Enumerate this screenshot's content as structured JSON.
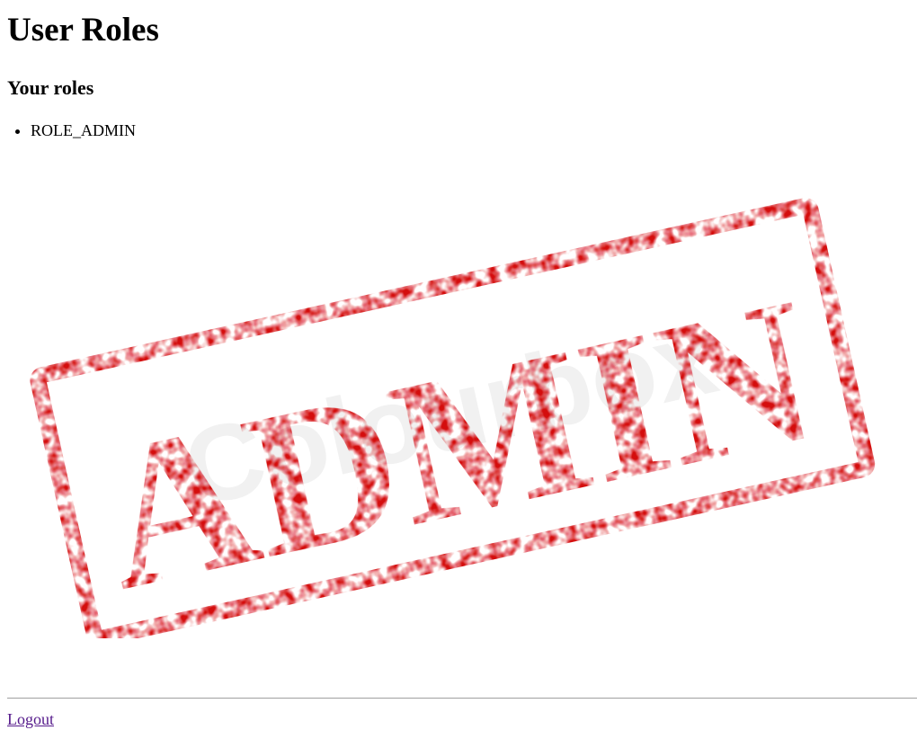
{
  "page": {
    "title": "User Roles"
  },
  "roles_section": {
    "heading": "Your roles",
    "roles": [
      "ROLE_ADMIN"
    ]
  },
  "stamp_image": {
    "text": "ADMIN",
    "watermark": "Colourbox",
    "color": "#d40a0f"
  },
  "footer": {
    "logout_label": "Logout",
    "link_color": "#551a8b"
  }
}
